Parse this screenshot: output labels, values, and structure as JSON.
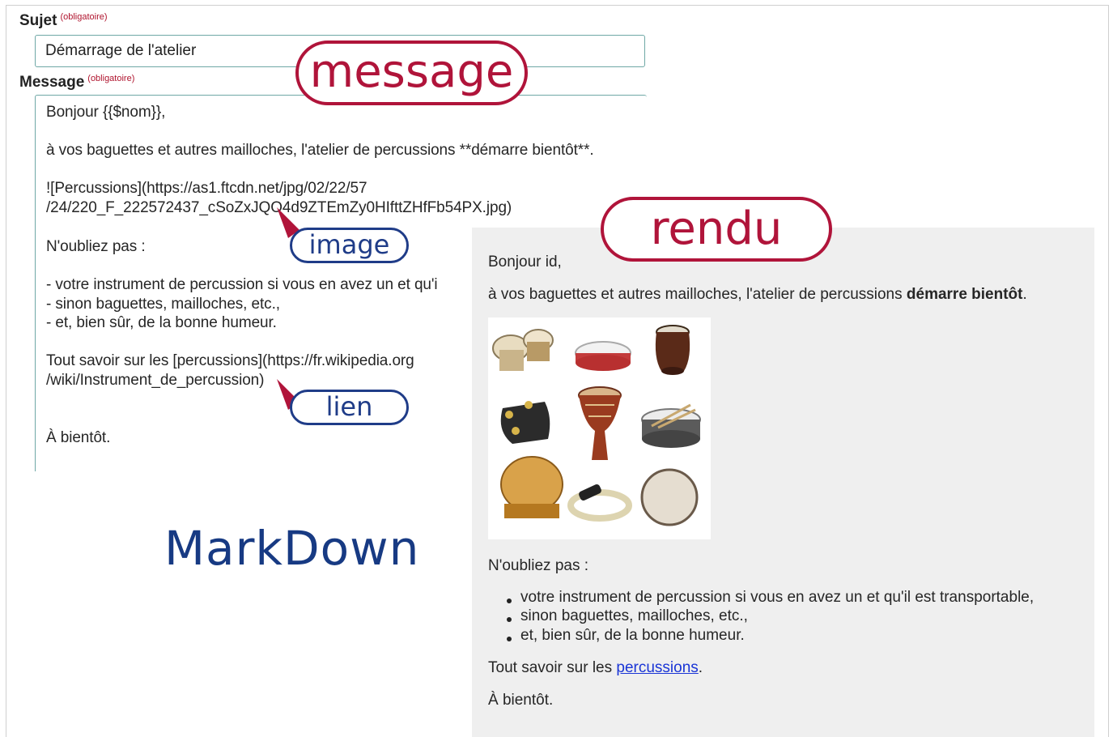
{
  "form": {
    "subject_label": "Sujet",
    "subject_required": "(obligatoire)",
    "subject_value": "Démarrage de l'atelier",
    "message_label": "Message",
    "message_required": "(obligatoire)",
    "message_lines": [
      "Bonjour {{$nom}},",
      "à vos baguettes et autres mailloches, l'atelier de percussions **démarre bientôt**.",
      "![Percussions](https://as1.ftcdn.net/jpg/02/22/57",
      "/24/220_F_222572437_cSoZxJQO4d9ZTEmZy0HIfttZHfFb54PX.jpg)",
      "N'oubliez pas :",
      "- votre instrument de percussion si vous en avez un et qu'i",
      "- sinon baguettes, mailloches, etc.,",
      "- et, bien sûr, de la bonne humeur.",
      "Tout savoir sur les [percussions](https://fr.wikipedia.org",
      "/wiki/Instrument_de_percussion)",
      "À bientôt."
    ]
  },
  "annotations": {
    "message": "message",
    "rendu": "rendu",
    "image": "image",
    "lien": "lien",
    "markdown": "MarkDown"
  },
  "preview": {
    "greeting": "Bonjour id,",
    "intro_before": "à vos baguettes et autres mailloches, l'atelier de percussions ",
    "intro_bold": "démarre bientôt",
    "intro_after": ".",
    "reminder": "N'oubliez pas :",
    "bullets": [
      "votre instrument de percussion si vous en avez un et qu'il est transportable,",
      "sinon baguettes, mailloches, etc.,",
      "et, bien sûr, de la bonne humeur."
    ],
    "link_before": "Tout savoir sur les ",
    "link_text": "percussions",
    "link_after": ".",
    "closing": "À bientôt."
  },
  "colors": {
    "accent_red": "#b0143a",
    "accent_blue": "#1f3c88",
    "link_blue": "#1a35d6",
    "field_border": "#6fa8a6"
  }
}
